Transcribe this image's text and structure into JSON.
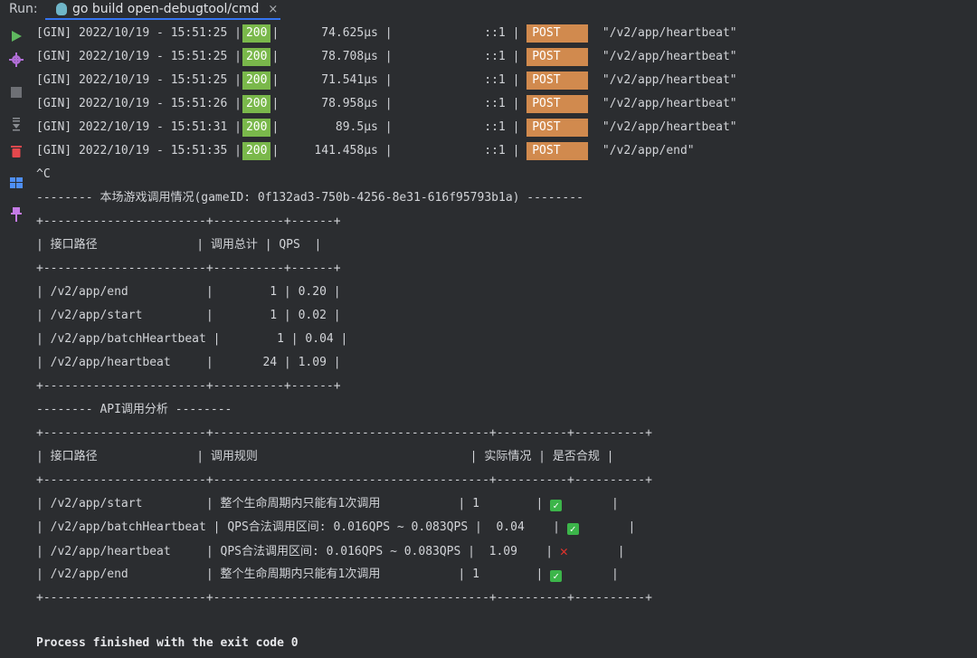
{
  "toolbar": {
    "run_label": "Run:",
    "tab_label": "go build open-debugtool/cmd",
    "tab_close": "×"
  },
  "sidebar": {
    "icons": [
      "play-icon",
      "debug-gear-icon",
      "stop-icon",
      "scroll-to-end-icon",
      "trash-icon",
      "layout-icon",
      "pin-icon"
    ]
  },
  "colors": {
    "status_ok_bg": "#7ab84b",
    "method_post_bg": "#d18a4e",
    "run_accent": "#3574f0"
  },
  "gin_logs": [
    {
      "prefix": "[GIN] 2022/10/19 - 15:51:25 |",
      "status": "200",
      "latency": "|      74.625µs |             ::1 |",
      "method": "POST",
      "path": "\"/v2/app/heartbeat\""
    },
    {
      "prefix": "[GIN] 2022/10/19 - 15:51:25 |",
      "status": "200",
      "latency": "|      78.708µs |             ::1 |",
      "method": "POST",
      "path": "\"/v2/app/heartbeat\""
    },
    {
      "prefix": "[GIN] 2022/10/19 - 15:51:25 |",
      "status": "200",
      "latency": "|      71.541µs |             ::1 |",
      "method": "POST",
      "path": "\"/v2/app/heartbeat\""
    },
    {
      "prefix": "[GIN] 2022/10/19 - 15:51:26 |",
      "status": "200",
      "latency": "|      78.958µs |             ::1 |",
      "method": "POST",
      "path": "\"/v2/app/heartbeat\""
    },
    {
      "prefix": "[GIN] 2022/10/19 - 15:51:31 |",
      "status": "200",
      "latency": "|        89.5µs |             ::1 |",
      "method": "POST",
      "path": "\"/v2/app/heartbeat\""
    },
    {
      "prefix": "[GIN] 2022/10/19 - 15:51:35 |",
      "status": "200",
      "latency": "|     141.458µs |             ::1 |",
      "method": "POST",
      "path": "\"/v2/app/end\""
    }
  ],
  "interrupt": "^C",
  "summary": {
    "title": "-------- 本场游戏调用情况(gameID: 0f132ad3-750b-4256-8e31-616f95793b1a) --------",
    "border": "+-----------------------+----------+------+",
    "header": "| 接口路径              | 调用总计 | QPS  |",
    "rows": [
      "| /v2/app/end           |        1 | 0.20 |",
      "| /v2/app/start         |        1 | 0.02 |",
      "| /v2/app/batchHeartbeat |        1 | 0.04 |",
      "| /v2/app/heartbeat     |       24 | 1.09 |"
    ]
  },
  "analysis": {
    "title": "-------- API调用分析 --------",
    "border": "+-----------------------+---------------------------------------+----------+----------+",
    "header": "| 接口路径              | 调用规则                              | 实际情况 | 是否合规 |",
    "rows": [
      {
        "text": "| /v2/app/start         | 整个生命周期内只能有1次调用           | 1        | ",
        "compliant": true,
        "tail": "       |"
      },
      {
        "text": "| /v2/app/batchHeartbeat | QPS合法调用区间: 0.016QPS ~ 0.083QPS |  0.04    | ",
        "compliant": true,
        "tail": "       |"
      },
      {
        "text": "| /v2/app/heartbeat     | QPS合法调用区间: 0.016QPS ~ 0.083QPS |  1.09    | ",
        "compliant": false,
        "tail": "       |"
      },
      {
        "text": "| /v2/app/end           | 整个生命周期内只能有1次调用           | 1        | ",
        "compliant": true,
        "tail": "       |"
      }
    ]
  },
  "exit_message": "Process finished with the exit code 0"
}
